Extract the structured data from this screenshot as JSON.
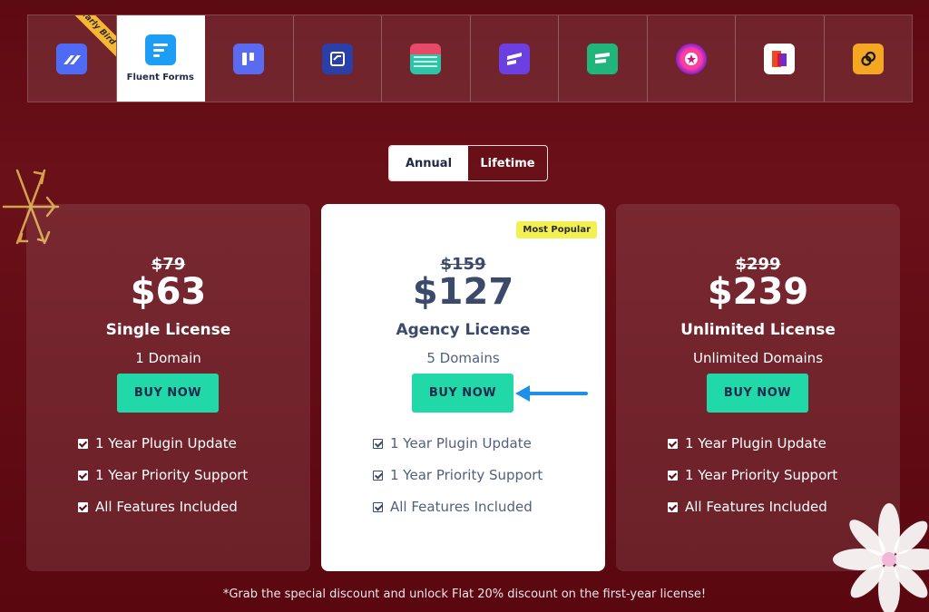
{
  "products": [
    {
      "name": "",
      "icon": "fluent-crm-icon",
      "color": "#4f6bf5",
      "ribbon": "Early Bird"
    },
    {
      "name": "Fluent Forms",
      "icon": "fluent-forms-icon",
      "color": "#1e9df5",
      "active": true
    },
    {
      "name": "",
      "icon": "fluent-boards-icon",
      "color": "#5a6bf2"
    },
    {
      "name": "",
      "icon": "fluent-support-icon",
      "color": "#2b3fa8"
    },
    {
      "name": "",
      "icon": "ninja-tables-icon",
      "color": "#e64a67"
    },
    {
      "name": "",
      "icon": "fluent-booking-icon",
      "color": "#6c3fe0"
    },
    {
      "name": "",
      "icon": "fluent-smtp-icon",
      "color": "#1fb57b"
    },
    {
      "name": "",
      "icon": "azonpress-icon",
      "color": "#c21a7a"
    },
    {
      "name": "",
      "icon": "paymattic-icon",
      "color": "#f0471e"
    },
    {
      "name": "",
      "icon": "wp-social-ninja-icon",
      "color": "#f5a623"
    }
  ],
  "toggle": {
    "annual": "Annual",
    "lifetime": "Lifetime"
  },
  "plans": [
    {
      "old_price": "$79",
      "price": "$63",
      "name": "Single License",
      "domains": "1 Domain",
      "button": "BUY NOW",
      "features": [
        "1 Year Plugin Update",
        "1 Year Priority Support",
        "All Features Included"
      ]
    },
    {
      "badge": "Most Popular",
      "old_price": "$159",
      "price": "$127",
      "name": "Agency License",
      "domains": "5 Domains",
      "button": "BUY NOW",
      "features": [
        "1 Year Plugin Update",
        "1 Year Priority Support",
        "All Features Included"
      ]
    },
    {
      "old_price": "$299",
      "price": "$239",
      "name": "Unlimited License",
      "domains": "Unlimited Domains",
      "button": "BUY NOW",
      "features": [
        "1 Year Plugin Update",
        "1 Year Priority Support",
        "All Features Included"
      ]
    }
  ],
  "footnote": "*Grab the special discount and unlock Flat 20% discount on the first-year license!",
  "colors": {
    "background": "#5e0a12",
    "button": "#21d8a8",
    "badge": "#f3f052",
    "arrow": "#1e90e8"
  }
}
